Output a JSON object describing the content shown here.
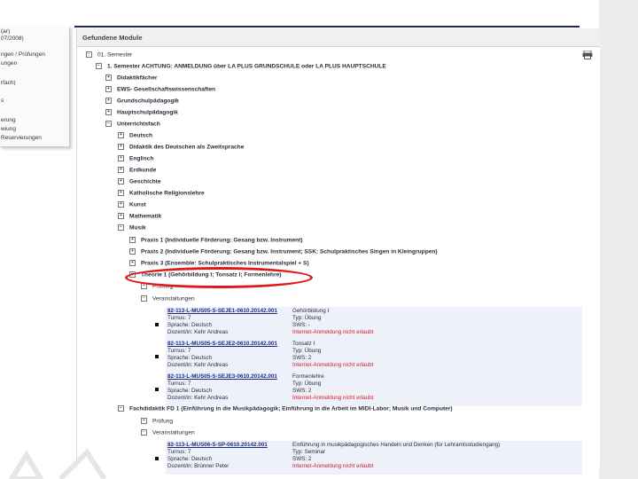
{
  "left_nav": {
    "lines": [
      "(ar)",
      "07/2008)",
      "ngen / Prüfungen",
      "ungen",
      "rfach)",
      "s",
      "erung",
      "wiung",
      "Reservierungen"
    ]
  },
  "panel": {
    "title": "Gefundene Module"
  },
  "tree": {
    "semester": "01. Semester",
    "semester_desc": "1. Semester ACHTUNG: ANMELDUNG über LA PLUS GRUNDSCHULE oder LA PLUS HAUPTSCHULE",
    "groups": [
      "Didaktikfächer",
      "EWS- Gesellschaftswissenschaften",
      "Grundschulpädagogik",
      "Hauptschulpädagogik",
      "Unterrichtsfach"
    ],
    "subjects": [
      "Deutsch",
      "Didaktik des Deutschen als Zweitsprache",
      "Englisch",
      "Erdkunde",
      "Geschichte",
      "Katholische Religionslehre",
      "Kunst",
      "Mathematik",
      "Musik"
    ],
    "musik_items": [
      "Praxis 1 (Individuelle Förderung: Gesang bzw. Instrument)",
      "Praxis 2 (Individuelle Förderung: Gesang bzw. Instrument; SSK: Schulpraktisches Singen in Kleingruppen)",
      "Praxis 3 (Ensemble: Schulpraktisches Instrumentalspiel + S)",
      "Theorie 1 (Gehörbildung I; Tonsatz I; Formenlehre)"
    ],
    "pruefung": "Prüfung",
    "veranstaltungen": "Veranstaltungen",
    "fachdidaktik": "Fachdidaktik FD 1 (Einführung in die Musikpädagogik; Einführung in die Arbeit im MIDI-Labor; Musik und Computer)",
    "pruefung2": "Prüfung",
    "veranstaltungen2": "Veranstaltungen"
  },
  "courses": [
    {
      "id": "82-113-L-MUS05-S-SEJE1-0610.20142.001",
      "title": "Gehörbildung I",
      "turnus": "Turnus: 7",
      "typ": "Typ: Übung",
      "sprache": "Sprache: Deutsch",
      "sws": "SWS: -",
      "dozent": "Dozent/in: Kehr Andreas",
      "status": "Internet-Anmeldung nicht erlaubt"
    },
    {
      "id": "82-113-L-MUS05-S-SEJE2-0610.20142.001",
      "title": "Tonsatz I",
      "turnus": "Turnus: 7",
      "typ": "Typ: Übung",
      "sprache": "Sprache: Deutsch",
      "sws": "SWS: 2",
      "dozent": "Dozent/in: Kehr Andreas",
      "status": "Internet-Anmeldung nicht erlaubt"
    },
    {
      "id": "82-113-L-MUS05-S-SEJE3-0610.20142.001",
      "title": "Formenlehre",
      "turnus": "Turnus: 7",
      "typ": "Typ: Übung",
      "sprache": "Sprache: Deutsch",
      "sws": "SWS: 2",
      "dozent": "Dozent/in: Kehr Andreas",
      "status": "Internet-Anmeldung nicht erlaubt"
    },
    {
      "id": "82-113-L-MUS06-S-SP-0610.20142.001",
      "title": "Einführung in musikpädagogisches Handeln und Denken (für Lehramtsstudiengang)",
      "turnus": "Turnus: 7",
      "typ": "Typ: Seminar",
      "sprache": "Sprache: Deutsch",
      "sws": "SWS: 2",
      "dozent": "Dozent/in: Brünner Peter",
      "status": "Internet-Anmeldung nicht erlaubt"
    }
  ],
  "colors": {
    "highlight": "#e01818",
    "topbar": "#1e2b5a",
    "link": "#1a2a80",
    "warning": "#d42020"
  }
}
